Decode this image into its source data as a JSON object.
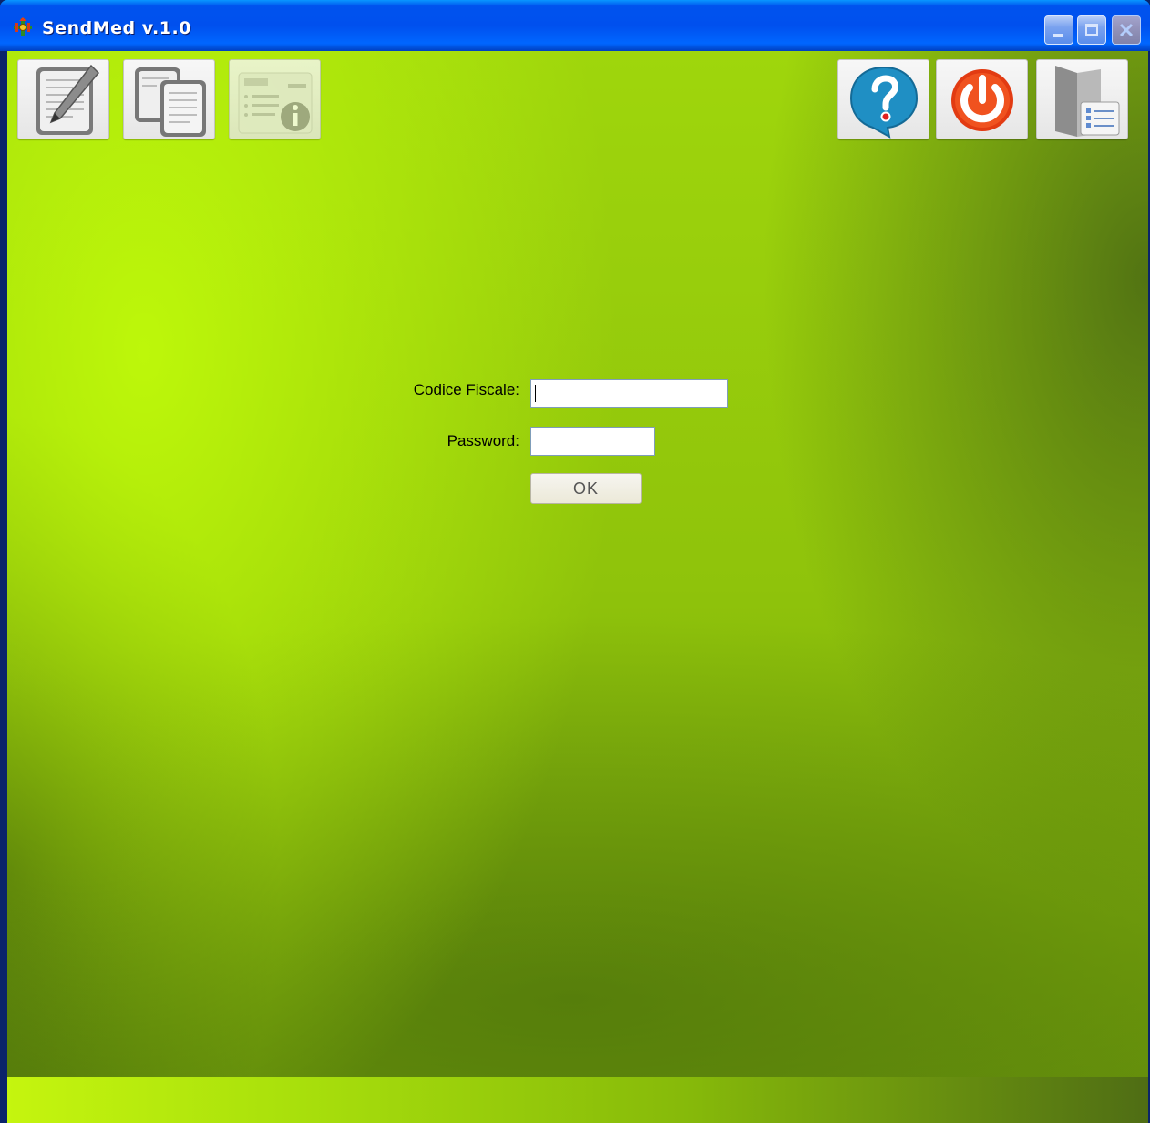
{
  "window": {
    "title": "SendMed v.1.0",
    "controls": [
      "minimize",
      "maximize",
      "close"
    ]
  },
  "toolbar": {
    "left": [
      {
        "name": "edit-document",
        "icon": "pencil-document-icon"
      },
      {
        "name": "copy-documents",
        "icon": "documents-icon"
      },
      {
        "name": "document-info",
        "icon": "document-info-icon"
      }
    ],
    "right": [
      {
        "name": "help",
        "icon": "help-bubble-icon"
      },
      {
        "name": "power",
        "icon": "power-icon"
      },
      {
        "name": "settings",
        "icon": "folder-checklist-icon"
      }
    ]
  },
  "login": {
    "codice_label": "Codice Fiscale:",
    "codice_value": "",
    "password_label": "Password:",
    "password_value": "",
    "ok_label": "OK"
  },
  "colors": {
    "background_light": "#c4ff0a",
    "background_dark": "#4f6d14",
    "titlebar": "#0050ee"
  }
}
